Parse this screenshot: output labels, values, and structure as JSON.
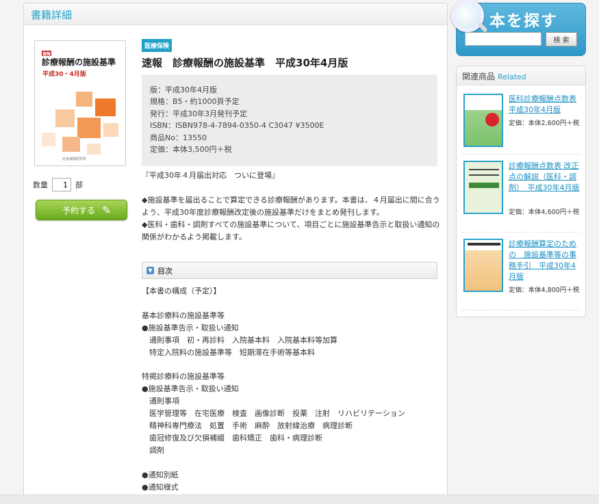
{
  "main": {
    "heading": "書籍詳細",
    "cover": {
      "badge": "速報",
      "title": "診療報酬の施設基準",
      "edition": "平成30・4月版",
      "publisher": "社会保険研究所"
    },
    "quantity": {
      "label": "数量",
      "value": "1",
      "unit": "部"
    },
    "reserve_label": "予約する",
    "category": "医療保険",
    "title": "速報　診療報酬の施設基準　平成30年4月版",
    "specs": [
      "版：平成30年4月版",
      "規格：B5・約1000頁予定",
      "発行：平成30年3月発刊予定",
      "ISBN：ISBN978-4-7894-0350-4 C3047 ¥3500E",
      "商品No：13550",
      "定価：本体3,500円＋税"
    ],
    "tagline": "『平成30年４月届出対応　ついに登場』",
    "description_1": "◆施設基準を届出ることで算定できる診療報酬があります。本書は、４月届出に間に合うよう、平成30年度診療報酬改定後の施設基準だけをまとめ発刊します。",
    "description_2": "◆医科・歯科・調剤すべての施設基準について、項目ごとに施設基準告示と取扱い通知の関係がわかるよう掲載します。",
    "toc_label": "目次",
    "toc_text": "【本書の構成（予定）】\n\n基本診療料の施設基準等\n●施設基準告示・取扱い通知\n　通則事項　初・再診料　入院基本料　入院基本料等加算\n　特定入院料の施設基準等　短期滞在手術等基本料\n\n特掲診療料の施設基準等\n●施設基準告示・取扱い通知\n　通則事項\n　医学管理等　在宅医療　検査　画像診断　投薬　注射　リハビリテーション\n　精神科専門療法　処置　手術　麻酔　放射線治療　病理診断\n　歯冠修復及び欠損補綴　歯科矯正　歯科・病理診断\n　調剤\n\n●通知別紙\n●通知様式"
  },
  "search": {
    "title": "本を探す",
    "button_label": "検 索",
    "placeholder": ""
  },
  "related": {
    "heading": "関連商品",
    "heading_en": "Related",
    "items": [
      {
        "title": "医科診療報酬点数表 平成30年4月版",
        "price": "定価：本体2,600円＋税"
      },
      {
        "title": "診療報酬点数表 改正点の解説（医科・調剤）　平成30年4月版",
        "price": "定価：本体4,600円＋税"
      },
      {
        "title": "診療報酬算定のための　施設基準等の事務手引　平成30年4月版",
        "price": "定価：本体4,800円＋税"
      }
    ]
  },
  "colors": {
    "accent": "#23a0c7",
    "reserve_green": "#6aab1c",
    "link": "#1a8fc2"
  }
}
